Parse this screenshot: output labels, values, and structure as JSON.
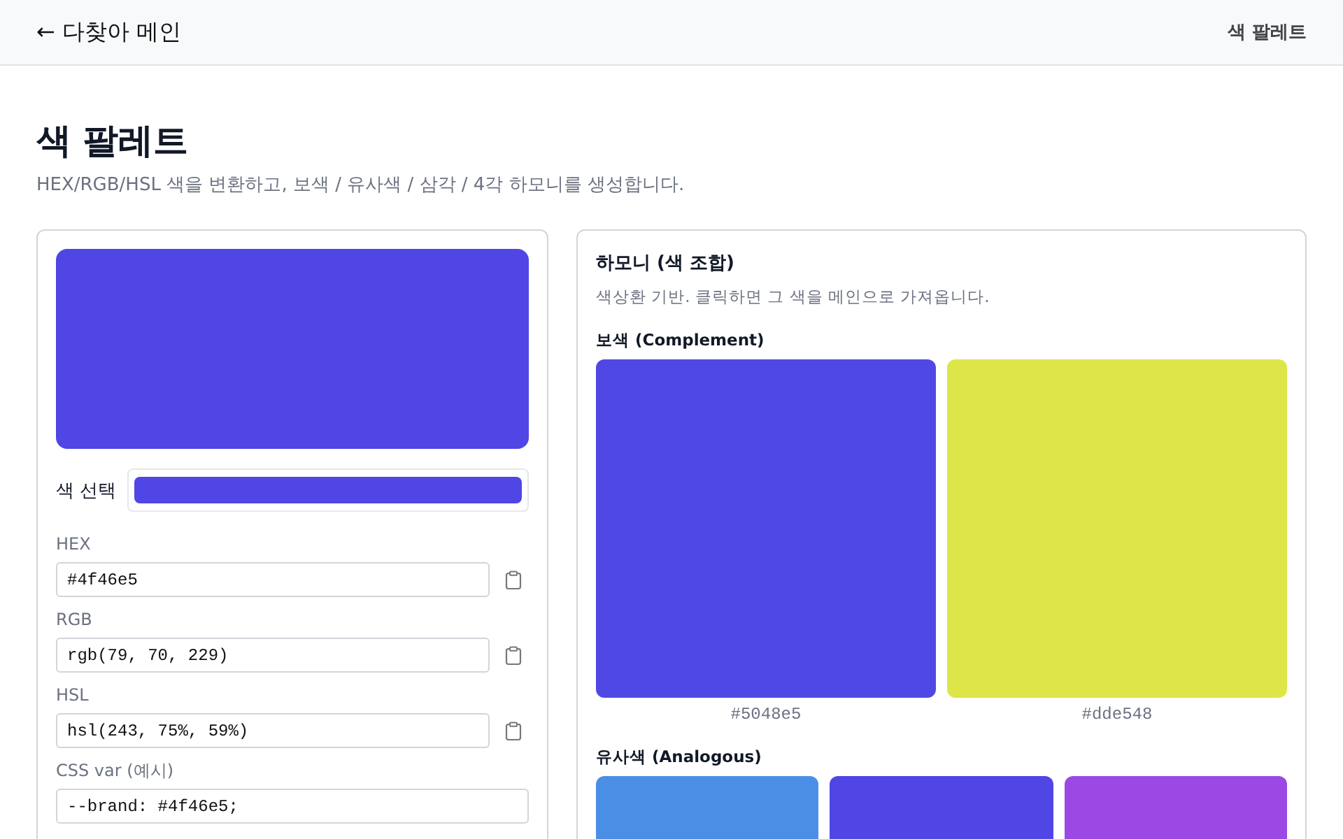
{
  "header": {
    "back_link": "← 다찾아 메인",
    "current_page": "색 팔레트"
  },
  "page": {
    "title": "색 팔레트",
    "description": "HEX/RGB/HSL 색을 변환하고, 보색 / 유사색 / 삼각 / 4각 하모니를 생성합니다."
  },
  "editor": {
    "preview": {
      "color": "#4f46e5"
    },
    "picker": {
      "label": "색 선택",
      "color": "#4f46e5"
    },
    "fields": [
      {
        "label": "HEX",
        "value": "#4f46e5",
        "copyable": true
      },
      {
        "label": "RGB",
        "value": "rgb(79, 70, 229)",
        "copyable": true
      },
      {
        "label": "HSL",
        "value": "hsl(243, 75%, 59%)",
        "copyable": true
      },
      {
        "label": "CSS var (예시)",
        "value": "--brand: #4f46e5;",
        "copyable": false
      }
    ]
  },
  "harmony": {
    "title": "하모니 (색 조합)",
    "description": "색상환 기반. 클릭하면 그 색을 메인으로 가져옵니다.",
    "groups": [
      {
        "label": "보색 (Complement)",
        "swatches": [
          {
            "color": "#5048e5",
            "hex": "#5048e5"
          },
          {
            "color": "#dde548",
            "hex": "#dde548"
          }
        ]
      },
      {
        "label": "유사색 (Analogous)",
        "swatches": [
          {
            "color": "#4a8fe5"
          },
          {
            "color": "#4f46e5"
          },
          {
            "color": "#9b48e5"
          }
        ]
      }
    ]
  }
}
